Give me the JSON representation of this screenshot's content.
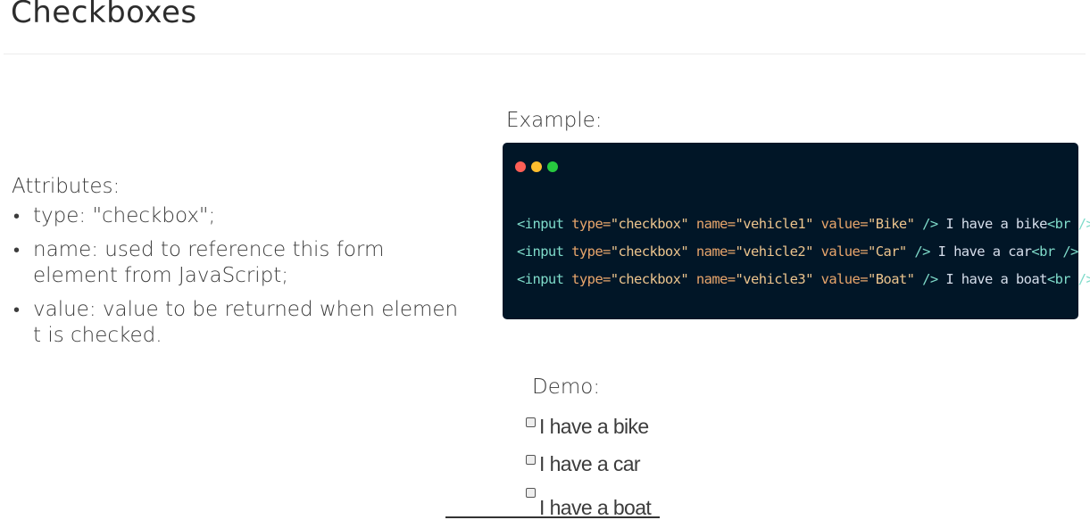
{
  "slide": {
    "title": "Checkboxes"
  },
  "attributes": {
    "heading": "Attributes:",
    "items": [
      "type: \"checkbox\";",
      "name: used to reference this form element from JavaScript;",
      "value: value to be returned when elemen t is checked."
    ]
  },
  "example": {
    "label": "Example:",
    "code_lines": [
      [
        {
          "t": "tag",
          "v": "<input "
        },
        {
          "t": "attr",
          "v": "type="
        },
        {
          "t": "str",
          "v": "\"checkbox\" "
        },
        {
          "t": "attr",
          "v": "name="
        },
        {
          "t": "str",
          "v": "\"vehicle1\" "
        },
        {
          "t": "attr",
          "v": "value="
        },
        {
          "t": "str",
          "v": "\"Bike\" "
        },
        {
          "t": "tag",
          "v": "/>"
        },
        {
          "t": "text",
          "v": " I have a bike"
        },
        {
          "t": "tag",
          "v": "<br />"
        }
      ],
      [
        {
          "t": "tag",
          "v": "<input "
        },
        {
          "t": "attr",
          "v": "type="
        },
        {
          "t": "str",
          "v": "\"checkbox\" "
        },
        {
          "t": "attr",
          "v": "name="
        },
        {
          "t": "str",
          "v": "\"vehicle2\" "
        },
        {
          "t": "attr",
          "v": "value="
        },
        {
          "t": "str",
          "v": "\"Car\" "
        },
        {
          "t": "tag",
          "v": "/>"
        },
        {
          "t": "text",
          "v": " I have a car"
        },
        {
          "t": "tag",
          "v": "<br />"
        }
      ],
      [
        {
          "t": "tag",
          "v": "<input "
        },
        {
          "t": "attr",
          "v": "type="
        },
        {
          "t": "str",
          "v": "\"checkbox\" "
        },
        {
          "t": "attr",
          "v": "name="
        },
        {
          "t": "str",
          "v": "\"vehicle3\" "
        },
        {
          "t": "attr",
          "v": "value="
        },
        {
          "t": "str",
          "v": "\"Boat\" "
        },
        {
          "t": "tag",
          "v": "/>"
        },
        {
          "t": "text",
          "v": " I have a boat"
        },
        {
          "t": "tag",
          "v": "<br />"
        }
      ]
    ]
  },
  "demo": {
    "label": "Demo:",
    "options": [
      {
        "label": "I have a bike",
        "checked": false
      },
      {
        "label": "I have a car",
        "checked": false
      },
      {
        "label": "I have a boat",
        "checked": false
      }
    ]
  },
  "colors": {
    "code_background": "#011627",
    "dot_red": "#ff5f56",
    "dot_yellow": "#ffbd2e",
    "dot_green": "#27c93f",
    "code_tag": "#7fdbca",
    "code_attr": "#e8a56b",
    "code_string": "#ecc48d",
    "code_text": "#d6deeb"
  }
}
